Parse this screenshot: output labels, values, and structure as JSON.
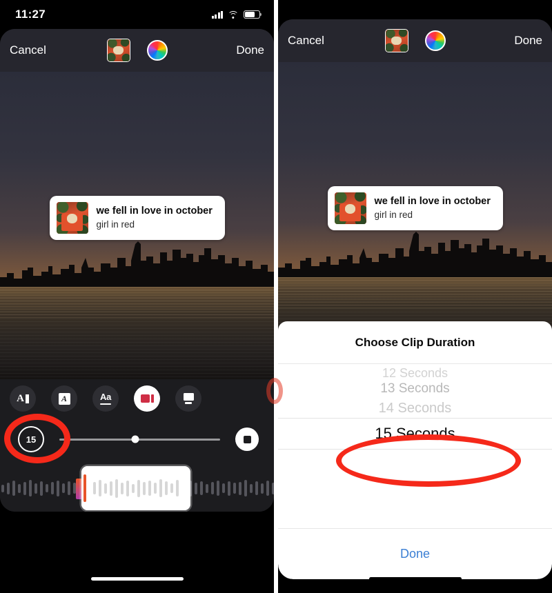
{
  "status_bar": {
    "time": "11:27",
    "icons": [
      "cellular-signal-icon",
      "wifi-icon",
      "battery-icon"
    ]
  },
  "left_panel": {
    "name": "instagram-story-music-editor",
    "editor_bar": {
      "cancel_label": "Cancel",
      "done_label": "Done",
      "album_thumb_name": "album-art-thumbnail",
      "color_wheel_name": "color-picker-wheel"
    },
    "music_sticker": {
      "title": "we fell in love in october",
      "artist": "girl in red"
    },
    "tools": [
      {
        "name": "text-style-tool",
        "glyph": "A-bar-icon",
        "active": false
      },
      {
        "name": "text-box-tool",
        "glyph": "boxed-A-icon",
        "active": false
      },
      {
        "name": "font-size-tool",
        "glyph": "Aa-icon",
        "active": false
      },
      {
        "name": "music-sticker-tool",
        "glyph": "music-card-icon",
        "active": true
      },
      {
        "name": "alignment-tool",
        "glyph": "align-icon",
        "active": false
      }
    ],
    "duration_button": {
      "value": "15",
      "name": "clip-duration-button"
    },
    "scrub_slider": {
      "name": "audio-scrub-slider",
      "position_percent": 47
    },
    "stop_button": {
      "name": "stop-playback-button"
    },
    "waveform": {
      "name": "audio-waveform-trimmer",
      "outer_bar_heights": [
        11,
        17,
        22,
        13,
        19,
        24,
        15,
        21,
        12,
        18,
        23,
        14,
        20,
        16,
        22,
        13,
        18,
        25,
        15,
        20,
        12,
        17,
        23,
        14,
        19,
        21,
        13,
        18,
        24,
        16,
        22,
        12,
        19,
        15,
        23,
        17,
        20,
        13,
        18,
        22,
        14,
        21,
        16,
        19,
        24,
        13,
        20,
        15,
        22,
        17,
        19,
        12,
        23,
        16,
        20,
        14,
        18,
        21,
        15,
        22
      ],
      "selection_bar_heights": [
        18,
        24,
        15,
        21,
        27,
        17,
        23,
        13,
        25,
        19,
        22,
        16,
        26,
        20,
        14,
        24
      ]
    }
  },
  "right_panel": {
    "name": "clip-duration-picker-screen",
    "editor_bar": {
      "cancel_label": "Cancel",
      "done_label": "Done",
      "album_thumb_name": "album-art-thumbnail",
      "color_wheel_name": "color-picker-wheel"
    },
    "music_sticker": {
      "title": "we fell in love in october",
      "artist": "girl in red"
    },
    "action_sheet": {
      "title": "Choose Clip Duration",
      "options": [
        "12 Seconds",
        "13 Seconds",
        "14 Seconds"
      ],
      "selected_option": "15 Seconds",
      "done_label": "Done"
    }
  },
  "annotations": {
    "left_highlight_target": "clip-duration-button",
    "right_highlight_target": "selected-duration-row",
    "color": "#f5291a"
  }
}
